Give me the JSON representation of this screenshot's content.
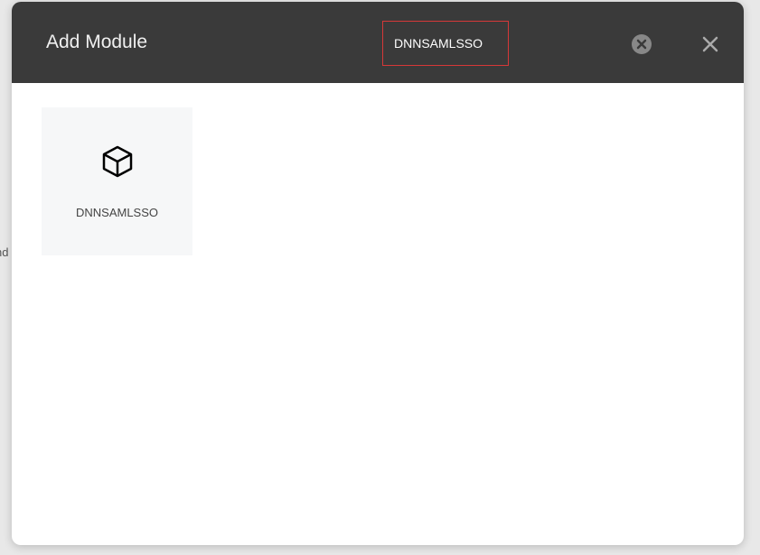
{
  "background": {
    "partial_text": "nd"
  },
  "modal": {
    "title": "Add Module",
    "search_value": "DNNSAMLSSO",
    "modules": [
      {
        "icon": "cube-icon",
        "label": "DNNSAMLSSO"
      }
    ]
  }
}
